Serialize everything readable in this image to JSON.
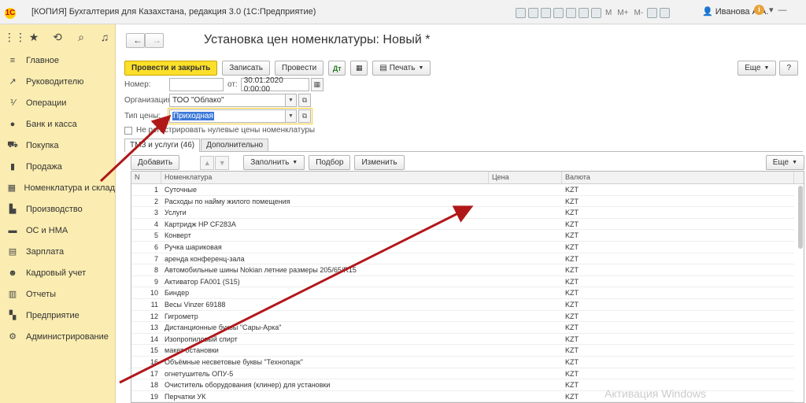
{
  "window": {
    "logo": "1С",
    "title": "[КОПИЯ] Бухгалтерия для Казахстана, редакция 3.0  (1С:Предприятие)",
    "m_buttons": [
      "M",
      "M+",
      "M-"
    ],
    "user": "Иванова А.А."
  },
  "sidebar": {
    "items": [
      {
        "label": "Главное",
        "icon": "menu-icon"
      },
      {
        "label": "Руководителю",
        "icon": "trend-icon"
      },
      {
        "label": "Операции",
        "icon": "operations-icon"
      },
      {
        "label": "Банк и касса",
        "icon": "coin-icon"
      },
      {
        "label": "Покупка",
        "icon": "cart-icon"
      },
      {
        "label": "Продажа",
        "icon": "bag-icon"
      },
      {
        "label": "Номенклатура и склад",
        "icon": "grid-icon"
      },
      {
        "label": "Производство",
        "icon": "factory-icon"
      },
      {
        "label": "ОС и НМА",
        "icon": "truck-icon"
      },
      {
        "label": "Зарплата",
        "icon": "salary-icon"
      },
      {
        "label": "Кадровый учет",
        "icon": "people-icon"
      },
      {
        "label": "Отчеты",
        "icon": "chart-icon"
      },
      {
        "label": "Предприятие",
        "icon": "building-icon"
      },
      {
        "label": "Администрирование",
        "icon": "gear-icon"
      }
    ]
  },
  "document": {
    "title": "Установка цен номенклатуры: Новый *",
    "toolbar": {
      "post_close": "Провести и закрыть",
      "save": "Записать",
      "post": "Провести",
      "print": "Печать",
      "more": "Еще",
      "help": "?"
    },
    "fields": {
      "number_label": "Номер:",
      "number_value": "",
      "date_label": "от:",
      "date_value": "30.01.2020  0:00:00",
      "org_label": "Организация:",
      "org_value": "ТОО \"Облако\"",
      "price_type_label": "Тип цены:",
      "price_type_value": "Приходная"
    },
    "checkbox_label": "Не регистрировать нулевые цены номенклатуры",
    "tabs": [
      "ТМЗ и услуги (46)",
      "Дополнительно"
    ],
    "table_toolbar": {
      "add": "Добавить",
      "fill": "Заполнить",
      "select": "Подбор",
      "change": "Изменить",
      "more": "Еще"
    },
    "columns": [
      "N",
      "Номенклатура",
      "Цена",
      "Валюта"
    ],
    "rows": [
      {
        "n": "1",
        "name": "Суточные",
        "price": "",
        "currency": "KZT"
      },
      {
        "n": "2",
        "name": "Расходы по найму жилого помещения",
        "price": "",
        "currency": "KZT"
      },
      {
        "n": "3",
        "name": "Услуги",
        "price": "",
        "currency": "KZT"
      },
      {
        "n": "4",
        "name": "Картридж HP CF283A",
        "price": "",
        "currency": "KZT"
      },
      {
        "n": "5",
        "name": "Конверт",
        "price": "",
        "currency": "KZT"
      },
      {
        "n": "6",
        "name": "Ручка шариковая",
        "price": "",
        "currency": "KZT"
      },
      {
        "n": "7",
        "name": "аренда конференц-зала",
        "price": "",
        "currency": "KZT"
      },
      {
        "n": "8",
        "name": "Автомобильные шины  Nokian летние размеры 205/65/R15",
        "price": "",
        "currency": "KZT"
      },
      {
        "n": "9",
        "name": "Активатор FA001 (S15)",
        "price": "",
        "currency": "KZT"
      },
      {
        "n": "10",
        "name": "Биндер",
        "price": "",
        "currency": "KZT"
      },
      {
        "n": "11",
        "name": "Весы Vinzer 69188",
        "price": "",
        "currency": "KZT"
      },
      {
        "n": "12",
        "name": "Гигрометр",
        "price": "",
        "currency": "KZT"
      },
      {
        "n": "13",
        "name": "Дистанционные буквы \"Сары-Арка\"",
        "price": "",
        "currency": "KZT"
      },
      {
        "n": "14",
        "name": "Изопропиловый спирт",
        "price": "",
        "currency": "KZT"
      },
      {
        "n": "15",
        "name": "макет остановки",
        "price": "",
        "currency": "KZT"
      },
      {
        "n": "16",
        "name": "Объёмные несветовые буквы \"Технопарк\"",
        "price": "",
        "currency": "KZT"
      },
      {
        "n": "17",
        "name": "огнетушитель ОПУ-5",
        "price": "",
        "currency": "KZT"
      },
      {
        "n": "18",
        "name": "Очиститель  оборудования (клинер) для установки",
        "price": "",
        "currency": "KZT"
      },
      {
        "n": "19",
        "name": "Перчатки УК",
        "price": "",
        "currency": "KZT"
      }
    ]
  },
  "watermark": "Активация Windows",
  "colors": {
    "sidebar_bg": "#fbedb1",
    "primary_button": "#fcdf2a",
    "annotation_arrow": "#b01818",
    "selection": "#3c78d8"
  }
}
